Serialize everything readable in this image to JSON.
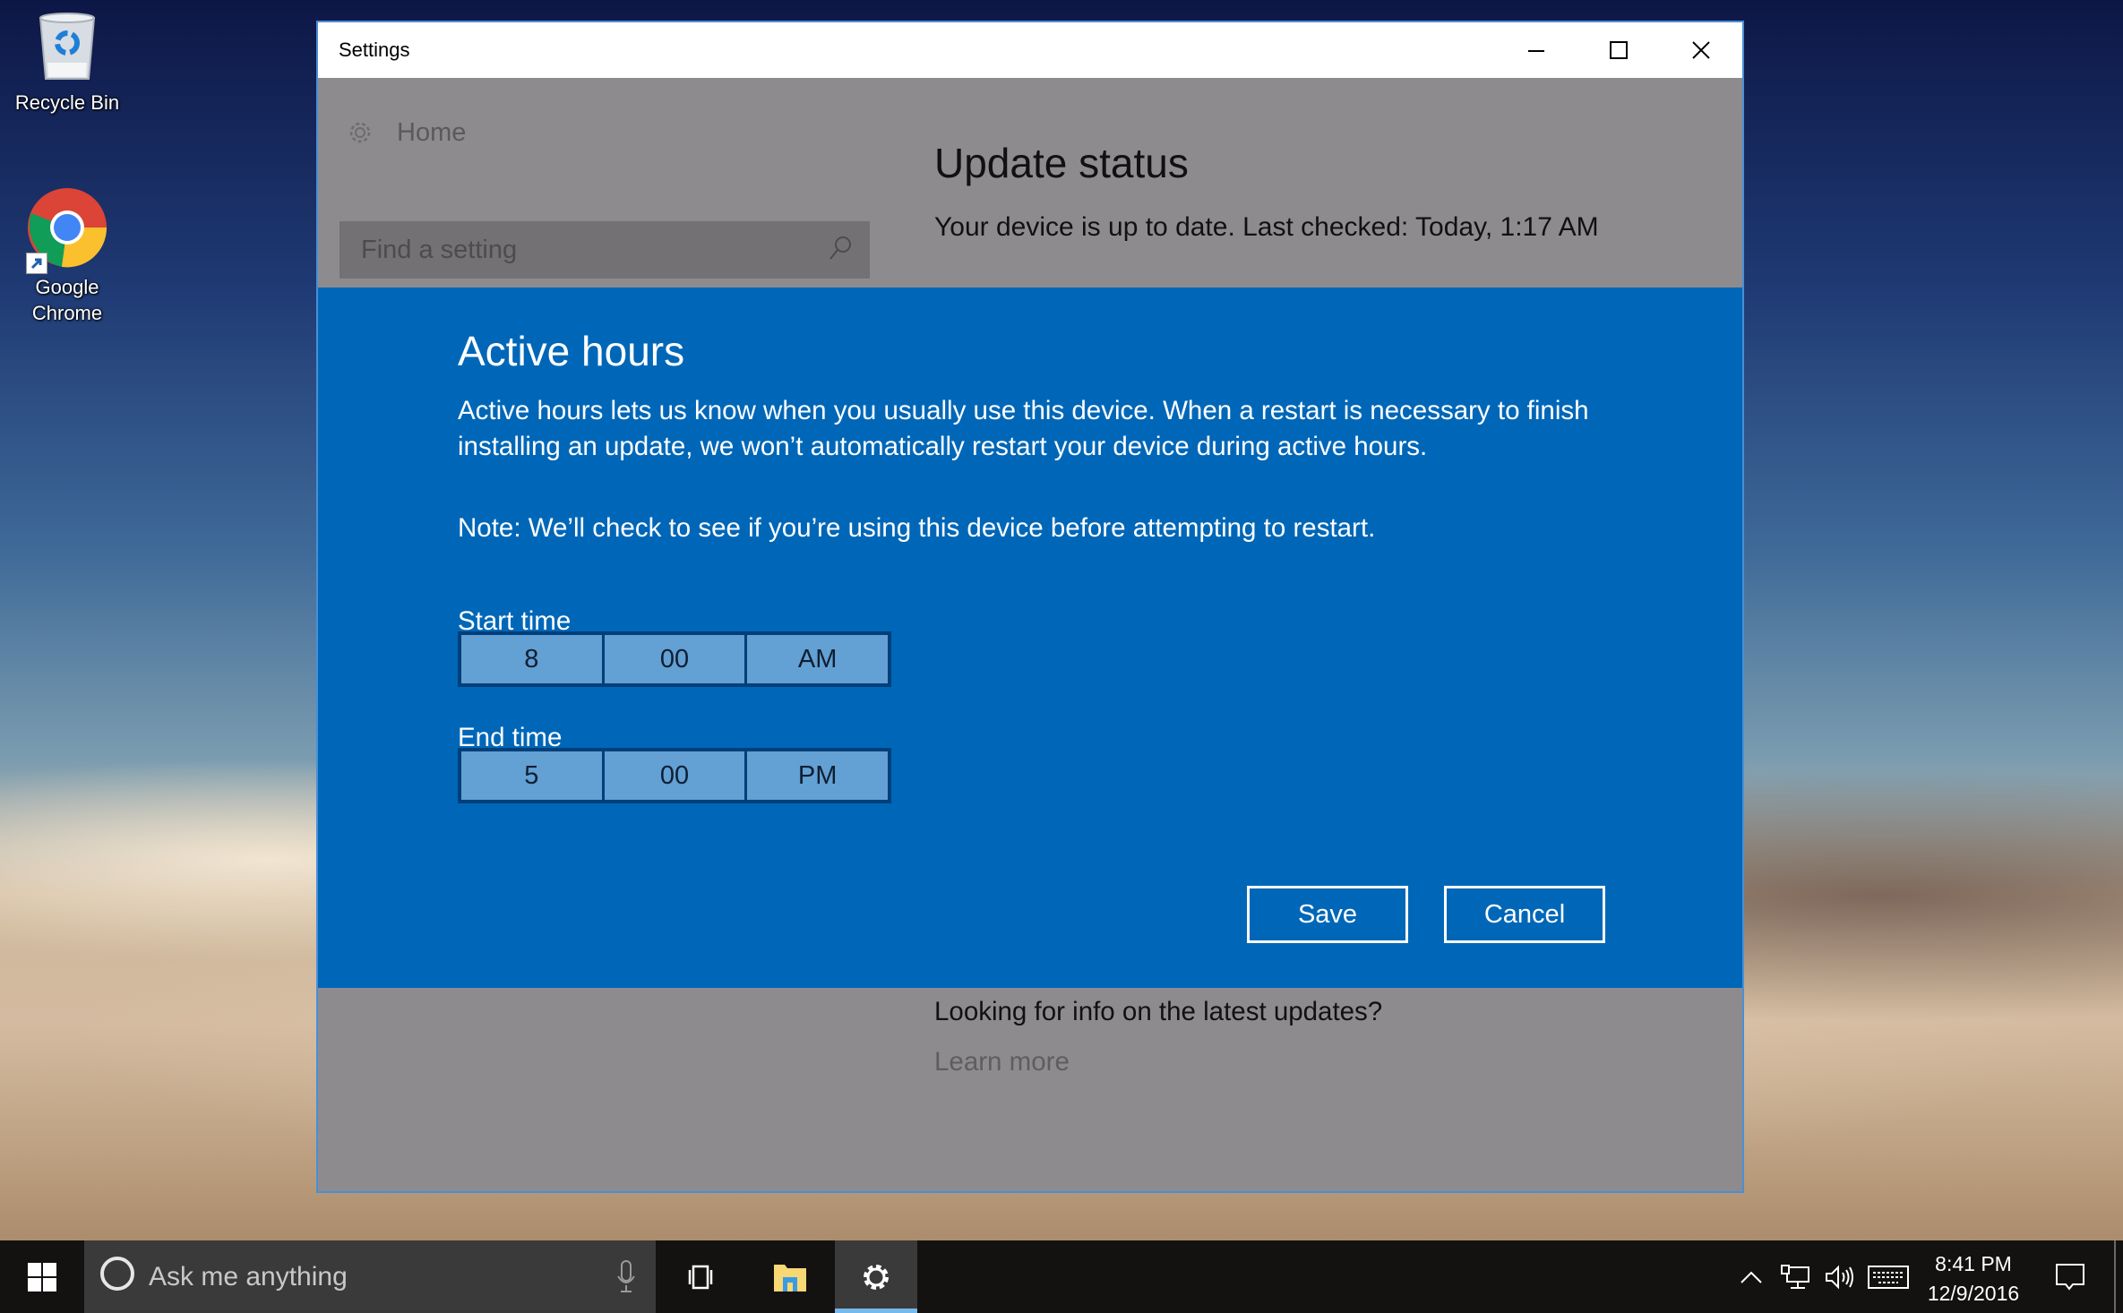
{
  "desktop": {
    "icons": [
      {
        "label": "Recycle Bin",
        "icon": "recycle-bin-icon"
      },
      {
        "label": "Google Chrome",
        "icon": "chrome-icon"
      }
    ]
  },
  "window": {
    "title": "Settings",
    "controls": {
      "minimize": "minimize-icon",
      "maximize": "maximize-icon",
      "close": "close-icon"
    }
  },
  "sidebar": {
    "home_label": "Home",
    "search_placeholder": "Find a setting"
  },
  "update": {
    "title": "Update status",
    "status": "Your device is up to date. Last checked: Today, 1:17 AM"
  },
  "active_hours": {
    "title": "Active hours",
    "description": "Active hours lets us know when you usually use this device. When a restart is necessary to finish installing an update, we won’t automatically restart your device during active hours.",
    "note": "Note: We’ll check to see if you’re using this device before attempting to restart.",
    "start": {
      "label": "Start time",
      "hour": "8",
      "minute": "00",
      "period": "AM"
    },
    "end": {
      "label": "End time",
      "hour": "5",
      "minute": "00",
      "period": "PM"
    },
    "save_label": "Save",
    "cancel_label": "Cancel"
  },
  "footer": {
    "question": "Looking for info on the latest updates?",
    "link": "Learn more"
  },
  "taskbar": {
    "search_placeholder": "Ask me anything",
    "clock_time": "8:41 PM",
    "clock_date": "12/9/2016"
  },
  "colors": {
    "accent": "#0067b8",
    "overlay_gray": "#8e8b8e",
    "picker_segment": "#63a0d3",
    "taskbar": "#141111",
    "taskbar_active_indicator": "#76b9ed"
  }
}
